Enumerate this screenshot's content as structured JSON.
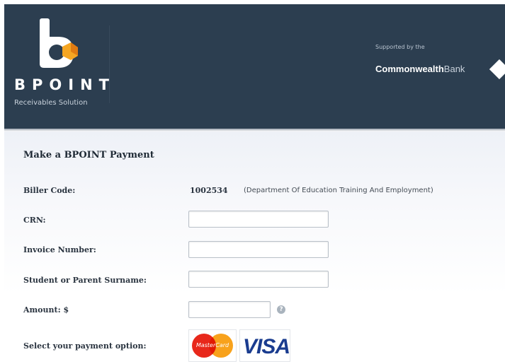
{
  "header": {
    "brand_name": "BPOINT",
    "brand_tagline": "Receivables Solution",
    "supported_by": "Supported by the",
    "bank_name_strong": "Commonwealth",
    "bank_name_light": "Bank"
  },
  "form": {
    "title": "Make a BPOINT Payment",
    "biller_code_label": "Biller Code:",
    "biller_code_value": "1002534",
    "biller_name": "(Department Of Education Training And Employment)",
    "crn_label": "CRN:",
    "crn_value": "",
    "invoice_label": "Invoice Number:",
    "invoice_value": "",
    "surname_label": "Student or Parent Surname:",
    "surname_value": "",
    "amount_label": "Amount: $",
    "amount_value": "",
    "help_symbol": "?",
    "payment_label": "Select your payment option:",
    "payment_options": [
      "MasterCard",
      "VISA"
    ]
  },
  "colors": {
    "header_bg": "#2c3e50",
    "logo_accent": "#f5a623",
    "mastercard_red": "#e8281b",
    "mastercard_yellow": "#f8a21c",
    "visa_blue": "#1a3c8f"
  }
}
